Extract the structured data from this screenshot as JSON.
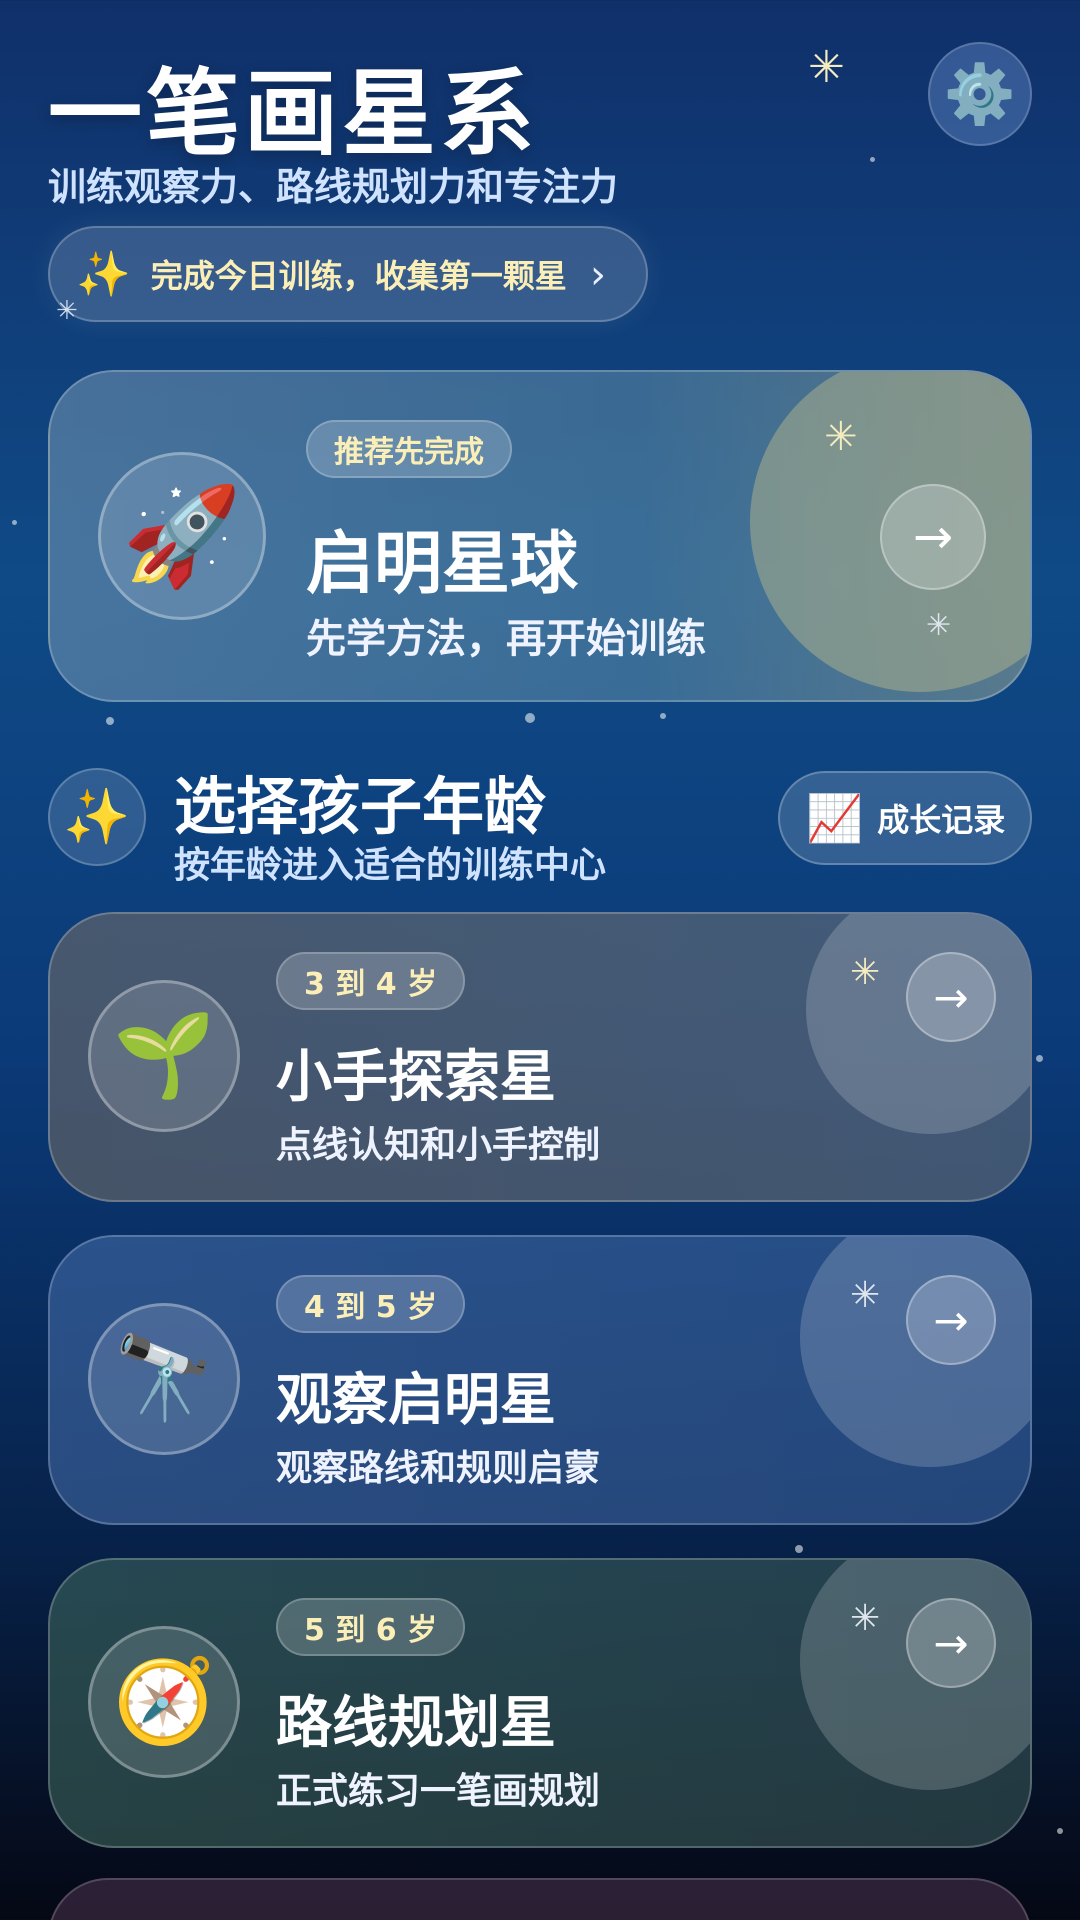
{
  "header": {
    "title": "一笔画星系",
    "subtitle": "训练观察力、路线规划力和专注力",
    "settings_icon": "⚙️",
    "daily_banner": {
      "icon": "✨",
      "text": "完成今日训练，收集第一颗星",
      "chevron": "›"
    }
  },
  "hero": {
    "icon": "🚀",
    "tag": "推荐先完成",
    "title": "启明星球",
    "description": "先学方法，再开始训练",
    "arrow": "→"
  },
  "section": {
    "icon": "✨",
    "title": "选择孩子年龄",
    "subtitle": "按年龄进入适合的训练中心",
    "growth_button": {
      "icon": "📈",
      "label": "成长记录"
    }
  },
  "age_groups": [
    {
      "icon": "🌱",
      "tag": "3 到 4 岁",
      "title": "小手探索星",
      "description": "点线认知和小手控制",
      "arrow": "→"
    },
    {
      "icon": "🔭",
      "tag": "4 到 5 岁",
      "title": "观察启明星",
      "description": "观察路线和规则启蒙",
      "arrow": "→"
    },
    {
      "icon": "🧭",
      "tag": "5 到 6 岁",
      "title": "路线规划星",
      "description": "正式练习一笔画规划",
      "arrow": "→"
    }
  ],
  "colors": {
    "tag_text": "#fbefb7",
    "subtitle_text": "#cfe2ff",
    "background_top": "#10306a",
    "background_bottom": "#050814"
  }
}
